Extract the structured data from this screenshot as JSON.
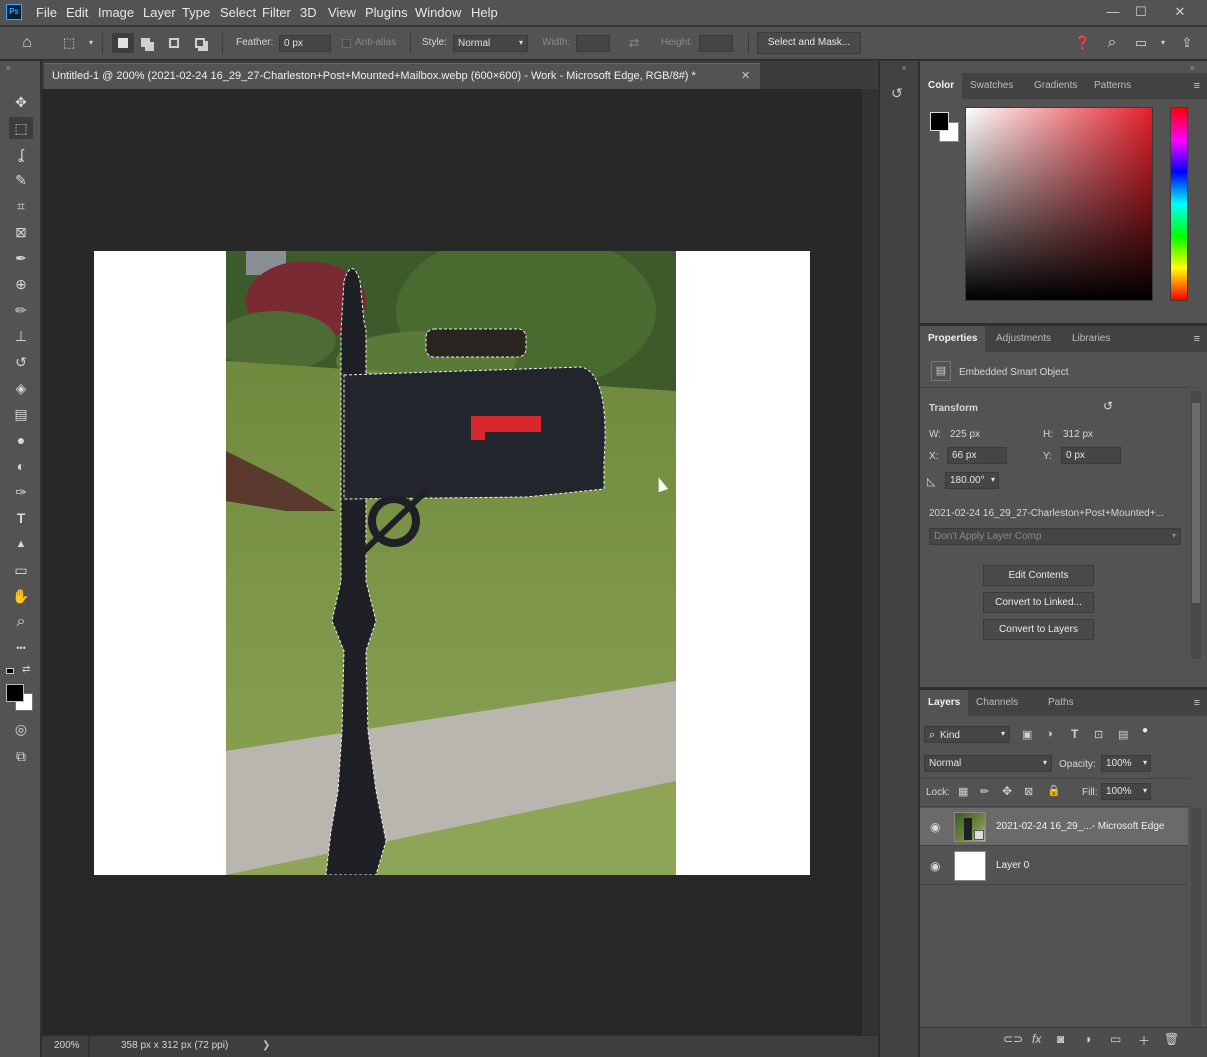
{
  "app": {
    "logo": "Ps"
  },
  "menu": [
    "File",
    "Edit",
    "Image",
    "Layer",
    "Type",
    "Select",
    "Filter",
    "3D",
    "View",
    "Plugins",
    "Window",
    "Help"
  ],
  "window_controls": {
    "minimize": "—",
    "maximize": "☐",
    "close": "✕"
  },
  "options": {
    "feather_label": "Feather:",
    "feather_value": "0 px",
    "antialias_label": "Anti-alias",
    "style_label": "Style:",
    "style_value": "Normal",
    "width_label": "Width:",
    "height_label": "Height:",
    "select_mask_label": "Select and Mask..."
  },
  "document": {
    "tab_title": "Untitled-1 @ 200% (2021-02-24 16_29_27-Charleston+Post+Mounted+Mailbox.webp (600×600) - Work - Microsoft Edge, RGB/8#) *",
    "close": "✕"
  },
  "status": {
    "zoom": "200%",
    "doc_info": "358 px x 312 px (72 ppi)",
    "arrow": "❯"
  },
  "color_panel": {
    "tabs": [
      "Color",
      "Swatches",
      "Gradients",
      "Patterns"
    ],
    "active": "Color",
    "foreground": "#000000",
    "background": "#ffffff",
    "hue_color": "#e5202a"
  },
  "properties": {
    "tabs": [
      "Properties",
      "Adjustments",
      "Libraries"
    ],
    "active": "Properties",
    "object_type": "Embedded Smart Object",
    "transform_label": "Transform",
    "w_label": "W:",
    "w_value": "225 px",
    "h_label": "H:",
    "h_value": "312 px",
    "x_label": "X:",
    "x_value": "66 px",
    "y_label": "Y:",
    "y_value": "0 px",
    "angle_value": "180.00°",
    "source_name": "2021-02-24  16_29_27-Charleston+Post+Mounted+...",
    "layer_comp": "Don't Apply Layer Comp",
    "buttons": [
      "Edit Contents",
      "Convert to Linked...",
      "Convert to Layers"
    ]
  },
  "layers": {
    "tabs": [
      "Layers",
      "Channels",
      "Paths"
    ],
    "active": "Layers",
    "kind_label": "Kind",
    "blend_mode": "Normal",
    "opacity_label": "Opacity:",
    "opacity_value": "100%",
    "lock_label": "Lock:",
    "fill_label": "Fill:",
    "fill_value": "100%",
    "items": [
      {
        "name": "2021-02-24 16_29_...- Microsoft Edge",
        "selected": true
      },
      {
        "name": "Layer 0",
        "selected": false
      }
    ]
  },
  "icons": {
    "home": "⌂",
    "marquee": "⬚",
    "move": "✥",
    "lasso": "ʆ",
    "quick-select": "✎",
    "crop": "⌗",
    "frame": "⊠",
    "eyedropper": "✒",
    "healing": "⊕",
    "brush": "✏",
    "stamp": "⊥",
    "history-brush": "↺",
    "eraser": "◈",
    "gradient": "▤",
    "blur": "●",
    "dodge": "◐",
    "pen": "✑",
    "type": "T",
    "path-select": "▲",
    "rectangle": "▭",
    "hand": "✋",
    "zoom": "⌕",
    "more": "•••",
    "swap": "⇄",
    "quick-mask": "◎",
    "screen-mode": "⧉",
    "eye": "👁",
    "search": "⌕",
    "menu": "≡",
    "link": "⊂⊃",
    "fx": "fx",
    "mask": "◙",
    "adjust": "◑",
    "folder": "▭",
    "new": "＋",
    "trash": "🗑"
  }
}
